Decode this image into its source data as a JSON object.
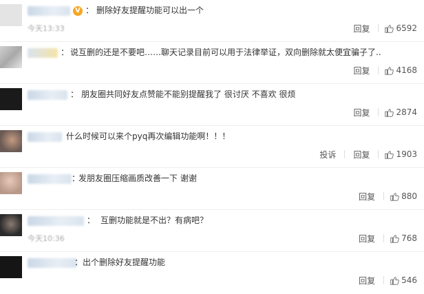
{
  "comments": [
    {
      "text": "删除好友提醒功能可以出一个",
      "meta": "今天13:33",
      "actions": [
        "回复"
      ],
      "likes": "6592",
      "vip": true
    },
    {
      "text": "说互删的还是不要吧……聊天记录目前可以用于法律举证，双向删除就太便宜骗子了..",
      "actions": [
        "回复"
      ],
      "likes": "4168"
    },
    {
      "text": "朋友圈共同好友点赞能不能别提醒我了 很讨厌 不喜欢 很烦",
      "actions": [
        "回复"
      ],
      "likes": "2874"
    },
    {
      "text": "什么时候可以来个pyq再次编辑功能啊！！！",
      "actions": [
        "投诉",
        "回复"
      ],
      "likes": "1903"
    },
    {
      "text": "发朋友圈压缩画质改善一下 谢谢",
      "actions": [
        "回复"
      ],
      "likes": "880"
    },
    {
      "text": "互删功能就是不出？有病吧？",
      "meta": "今天10:36",
      "actions": [
        "回复"
      ],
      "likes": "768"
    },
    {
      "text": "出个删除好友提醒功能",
      "actions": [
        "回复"
      ],
      "likes": "546"
    }
  ],
  "colors": {
    "avatar_tones": [
      "#ddd",
      "#c9c9c9",
      "#1a1a1a",
      "#b49a8c",
      "#d8b7a8",
      "#3a3a3a",
      "#151515"
    ]
  }
}
